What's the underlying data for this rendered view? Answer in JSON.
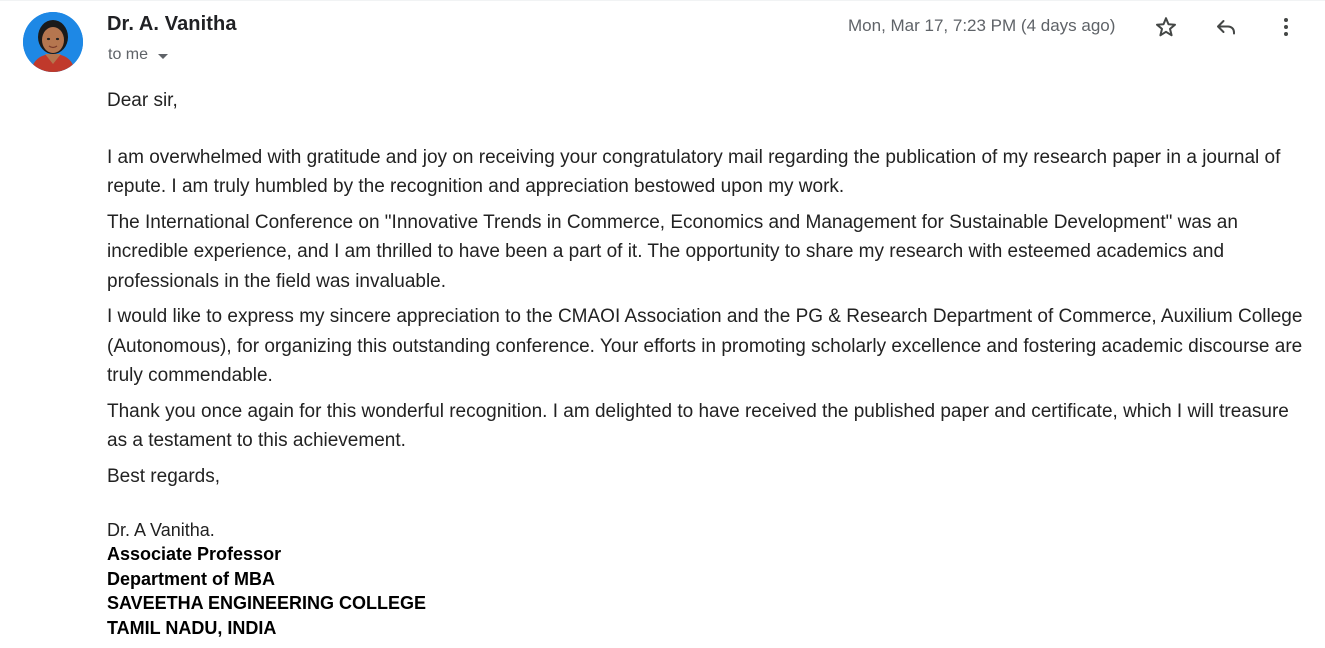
{
  "sender": {
    "name": "Dr. A. Vanitha",
    "recipient_label": "to me",
    "timestamp": "Mon, Mar 17, 7:23 PM (4 days ago)"
  },
  "icons": {
    "avatar": "sender-avatar",
    "star": "star-icon",
    "reply": "reply-icon",
    "more": "more-vert-icon",
    "caret": "caret-down-icon"
  },
  "message": {
    "greeting": "Dear sir,",
    "paragraphs": [
      "I am overwhelmed with gratitude and joy on receiving your congratulatory mail regarding the publication of my research paper in a journal of repute. I am truly humbled by the recognition and appreciation bestowed upon my work.",
      "The International Conference on \"Innovative Trends in Commerce, Economics and Management for Sustainable Development\" was an incredible experience, and I am thrilled to have been a part of it. The opportunity to share my research with esteemed academics and professionals in the field was invaluable.",
      "I would like to express my sincere appreciation to the CMAOI Association and the PG & Research Department of Commerce, Auxilium College (Autonomous), for organizing this outstanding conference. Your efforts in promoting scholarly excellence and fostering academic discourse are truly commendable.",
      "Thank you once again for this wonderful recognition. I am delighted to have received the published paper and certificate, which I will treasure as a testament to this achievement."
    ],
    "closing": "Best regards,",
    "signature": {
      "name": "Dr. A Vanitha.",
      "title": "Associate Professor",
      "department": "Department of MBA",
      "institution": "SAVEETHA ENGINEERING COLLEGE",
      "location": "TAMIL NADU, INDIA"
    }
  }
}
